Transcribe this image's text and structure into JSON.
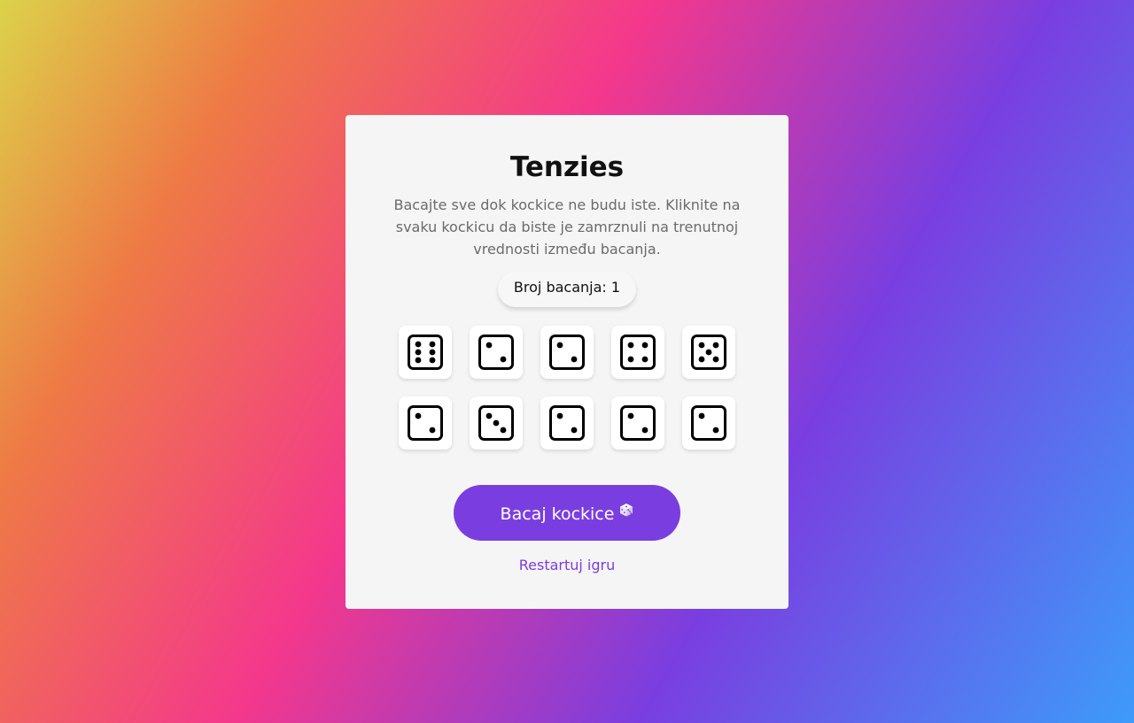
{
  "game": {
    "title": "Tenzies",
    "description": "Bacajte sve dok kockice ne budu iste. Kliknite na svaku kockicu da biste je zamrznuli na trenutnoj vrednosti između bacanja.",
    "roll_count_label": "Broj bacanja: 1",
    "roll_button_label": "Bacaj kockice",
    "roll_button_icon": "dice-icon",
    "restart_label": "Restartuj igru",
    "dice": [
      {
        "value": 6,
        "held": false
      },
      {
        "value": 2,
        "held": false
      },
      {
        "value": 2,
        "held": false
      },
      {
        "value": 4,
        "held": false
      },
      {
        "value": 5,
        "held": false
      },
      {
        "value": 2,
        "held": false
      },
      {
        "value": 3,
        "held": false
      },
      {
        "value": 2,
        "held": false
      },
      {
        "value": 2,
        "held": false
      },
      {
        "value": 2,
        "held": false
      }
    ]
  },
  "colors": {
    "accent": "#7a3ee0",
    "card_background": "#f5f5f5",
    "die_background": "#ffffff",
    "pip": "#000000"
  }
}
